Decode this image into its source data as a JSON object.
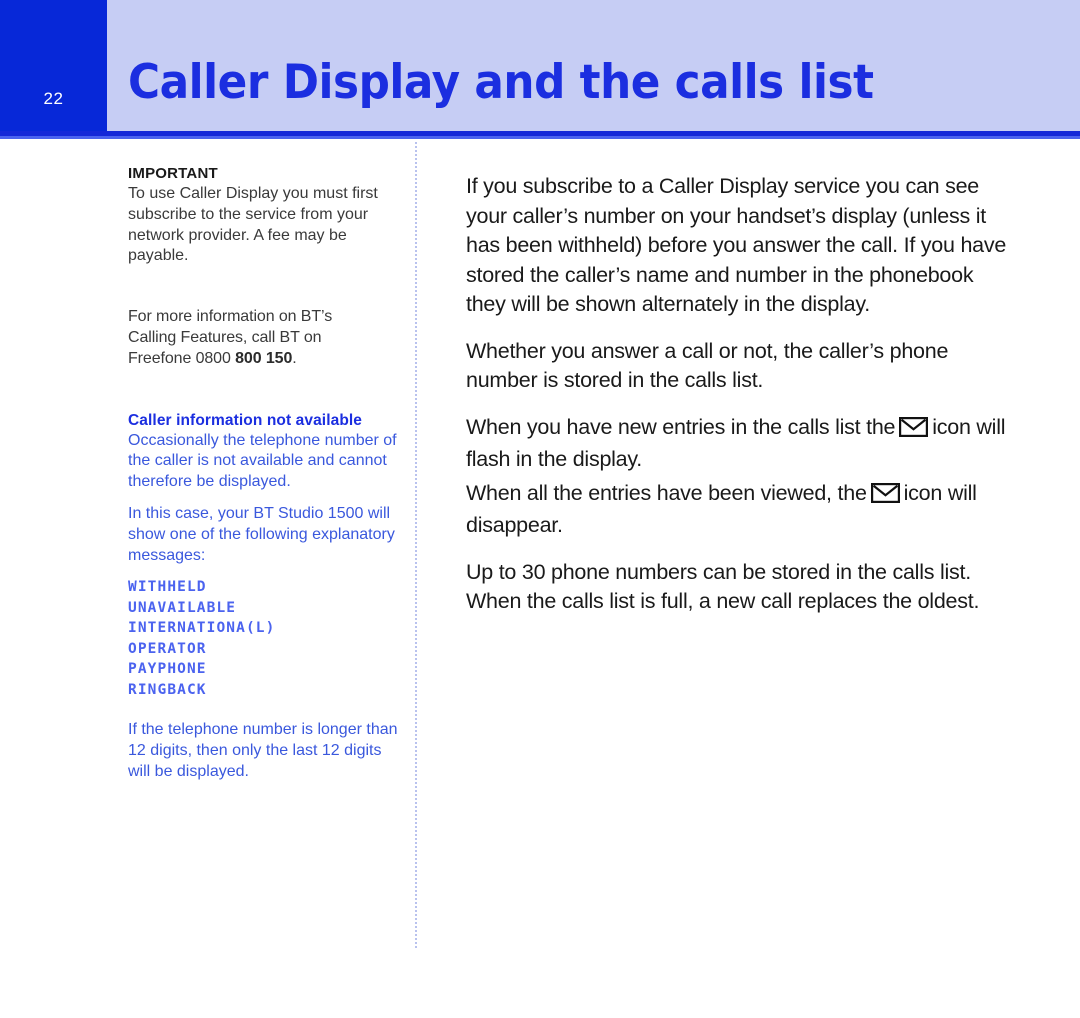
{
  "header": {
    "page_number": "22",
    "title": "Caller Display and the calls list",
    "accent_dark_blue": "#0728d8",
    "accent_light_blue": "#c6cdf4",
    "title_color": "#1b2ee0"
  },
  "sidebar": {
    "important_heading": "IMPORTANT",
    "important_body": "To use Caller Display you must first subscribe to the service from your network provider. A fee may be payable.",
    "more_info_line1": "For more information on BT’s",
    "more_info_line2": "Calling Features, call BT on",
    "more_info_line3_prefix": "Freefone 0800 ",
    "more_info_line3_bold": "800 150",
    "more_info_line3_suffix": ".",
    "caller_info_heading": "Caller information not available",
    "caller_info_body": "Occasionally the telephone number of the caller is not available and cannot therefore be displayed.",
    "in_this_case_body": "In this case, your BT Studio 1500 will show one of the following explanatory messages:",
    "display_messages": [
      "WITHHELD",
      "UNAVAILABLE",
      "INTERNATIONA(L)",
      "OPERATOR",
      "PAYPHONE",
      "RINGBACK"
    ],
    "digits_note": "If the telephone number is longer than 12 digits, then only the last 12 digits will be displayed.",
    "blue_text_color": "#3a58dd",
    "lcd_text_color": "#4b63ef"
  },
  "main": {
    "para1": "If you subscribe to a Caller Display service you can see your caller’s number on your handset’s display (unless it has been withheld) before you answer the call. If you have stored the caller’s name and number in the phonebook they will be shown alternately in the display.",
    "para2": "Whether you answer a call or not, the caller’s phone number is stored in the calls list.",
    "para3_before_icon": "When you have new entries in the calls list the",
    "para3_icon": "envelope-icon",
    "para3_after_icon": "icon will flash in the display.",
    "para4_before_icon": "When all the entries have been viewed, the",
    "para4_icon": "envelope-icon",
    "para4_after_icon": "icon will disappear.",
    "para5": "Up to 30 phone numbers can be stored in the calls list. When the calls list is full, a new call replaces the oldest."
  }
}
